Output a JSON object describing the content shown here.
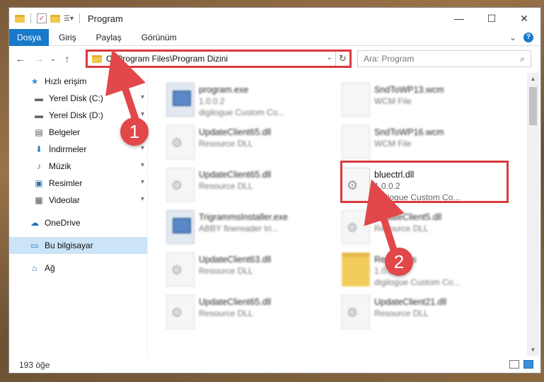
{
  "window": {
    "title": "Program",
    "controls": {
      "minimize": "—",
      "maximize": "☐",
      "close": "✕"
    }
  },
  "ribbon": {
    "tabs": [
      "Dosya",
      "Giriş",
      "Paylaş",
      "Görünüm"
    ],
    "expand": "⌄",
    "help": "?"
  },
  "nav": {
    "back": "←",
    "forward": "→",
    "recent": "⌄",
    "up": "↑",
    "address": "C:\\Program Files\\Program Dizini",
    "address_dropdown": "⌄",
    "refresh": "↻",
    "search_placeholder": "Ara: Program",
    "search_icon": "⌕"
  },
  "sidebar": {
    "items": [
      {
        "label": "Hızlı erişim",
        "icon": "star-icon",
        "glyph": "★",
        "pinned": false
      },
      {
        "label": "Yerel Disk (C:)",
        "icon": "drive-icon",
        "glyph": "▬",
        "pinned": true
      },
      {
        "label": "Yerel Disk (D:)",
        "icon": "drive-icon",
        "glyph": "▬",
        "pinned": true
      },
      {
        "label": "Belgeler",
        "icon": "documents-icon",
        "glyph": "▤",
        "pinned": true
      },
      {
        "label": "İndirmeler",
        "icon": "download-icon",
        "glyph": "⬇",
        "pinned": true
      },
      {
        "label": "Müzik",
        "icon": "music-icon",
        "glyph": "♪",
        "pinned": true
      },
      {
        "label": "Resimler",
        "icon": "pictures-icon",
        "glyph": "▣",
        "pinned": true
      },
      {
        "label": "Videolar",
        "icon": "video-icon",
        "glyph": "▦",
        "pinned": true
      },
      {
        "label": "OneDrive",
        "icon": "cloud-icon",
        "glyph": "☁",
        "pinned": false
      },
      {
        "label": "Bu bilgisayar",
        "icon": "computer-icon",
        "glyph": "▭",
        "pinned": false
      },
      {
        "label": "Ağ",
        "icon": "network-icon",
        "glyph": "⌂",
        "pinned": false
      }
    ],
    "pin_glyph": "📌"
  },
  "files": {
    "col1": [
      {
        "name": "program.exe",
        "line1": "1.0.0.2",
        "line2": "digilogue Custom Co...",
        "type": "exe"
      },
      {
        "name": "UpdateClient65.dll",
        "line1": "Resource DLL",
        "line2": "",
        "type": "doc"
      },
      {
        "name": "UpdateClient65.dll",
        "line1": "Resource DLL",
        "line2": "",
        "type": "doc"
      },
      {
        "name": "TrigrammsInstaller.exe",
        "line1": "ABBY finereader tri...",
        "line2": "",
        "type": "exe"
      },
      {
        "name": "UpdateClient63.dll",
        "line1": "Resource DLL",
        "line2": "",
        "type": "doc"
      },
      {
        "name": "UpdateClient65.dll",
        "line1": "Resource DLL",
        "line2": "",
        "type": "doc"
      }
    ],
    "col2": [
      {
        "name": "SndToWP13.wcm",
        "line1": "WCM File",
        "line2": "",
        "type": "doc"
      },
      {
        "name": "SndToWP16.wcm",
        "line1": "WCM File",
        "line2": "",
        "type": "doc"
      },
      {
        "name": "bluectrl.dll",
        "line1": "1.0.0.2",
        "line2": "digilogue Custom Co...",
        "type": "doc"
      },
      {
        "name": "UpdateClient5.dll",
        "line1": "Resource DLL",
        "line2": "",
        "type": "doc"
      },
      {
        "name": "Resources",
        "line1": "1.0.0",
        "line2": "digilogue Custom Co...",
        "type": "fold"
      },
      {
        "name": "UpdateClient21.dll",
        "line1": "Resource DLL",
        "line2": "",
        "type": "doc"
      }
    ]
  },
  "status": {
    "count": "193 öğe"
  },
  "annotations": {
    "badge1": "1",
    "badge2": "2"
  },
  "colors": {
    "accent": "#1979ca",
    "highlight": "#d9393e",
    "selected": "#cce4f7"
  }
}
